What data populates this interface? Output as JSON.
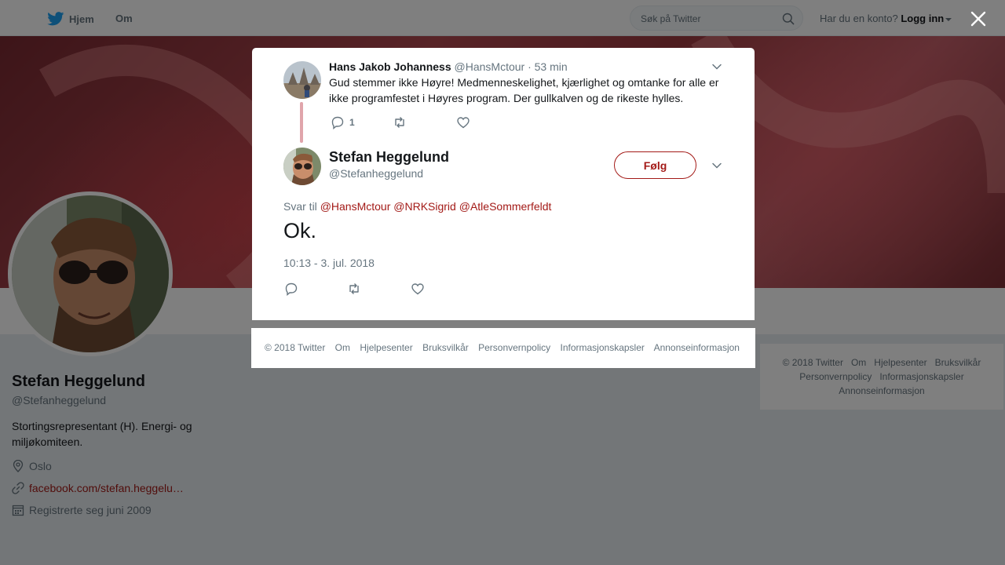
{
  "nav": {
    "home_label": "Hjem",
    "about_label": "Om",
    "search_placeholder": "Søk på Twitter",
    "account_prompt": "Har du en konto?",
    "login_label": "Logg inn"
  },
  "profile": {
    "name": "Stefan Heggelund",
    "handle": "@Stefanheggelund",
    "bio": "Stortingsrepresentant (H). Energi- og miljøkomiteen.",
    "location": "Oslo",
    "website": "facebook.com/stefan.heggelu…",
    "joined": "Registrerte seg juni 2009"
  },
  "side_footer": {
    "row1": [
      "© 2018 Twitter",
      "Om",
      "Hjelpesenter",
      "Bruksvilkår"
    ],
    "row2": [
      "Personvernpolicy",
      "Informasjonskapsler"
    ],
    "row3": [
      "Annonseinformasjon"
    ]
  },
  "quoted_tweet": {
    "author_name": "Hans Jakob Johanness",
    "author_handle": "@HansMctour",
    "time_ago": "· 53 min",
    "text": "Gud stemmer ikke Høyre! Medmenneskelighet, kjærlighet og omtanke for alle er ikke programfestet i Høyres program. Der gullkalven og de rikeste hylles.",
    "reply_count": "1"
  },
  "main_tweet": {
    "author_name": "Stefan Heggelund",
    "author_handle": "@Stefanheggelund",
    "follow_label": "Følg",
    "reply_to_prefix": "Svar til",
    "mentions": [
      "@HansMctour",
      "@NRKSigrid",
      "@AtleSommerfeldt"
    ],
    "text": "Ok.",
    "timestamp": "10:13 - 3. jul. 2018"
  },
  "modal_footer": [
    "© 2018 Twitter",
    "Om",
    "Hjelpesenter",
    "Bruksvilkår",
    "Personvernpolicy",
    "Informasjonskapsler",
    "Annonseinformasjon"
  ],
  "colors": {
    "accent": "#a31a17",
    "muted_text": "#66757f",
    "twitter_blue": "#1da1f2"
  },
  "icons": [
    "twitter-bird-icon",
    "search-icon",
    "close-icon",
    "location-icon",
    "link-icon",
    "calendar-icon",
    "reply-icon",
    "retweet-icon",
    "like-icon",
    "chevron-down-icon"
  ]
}
